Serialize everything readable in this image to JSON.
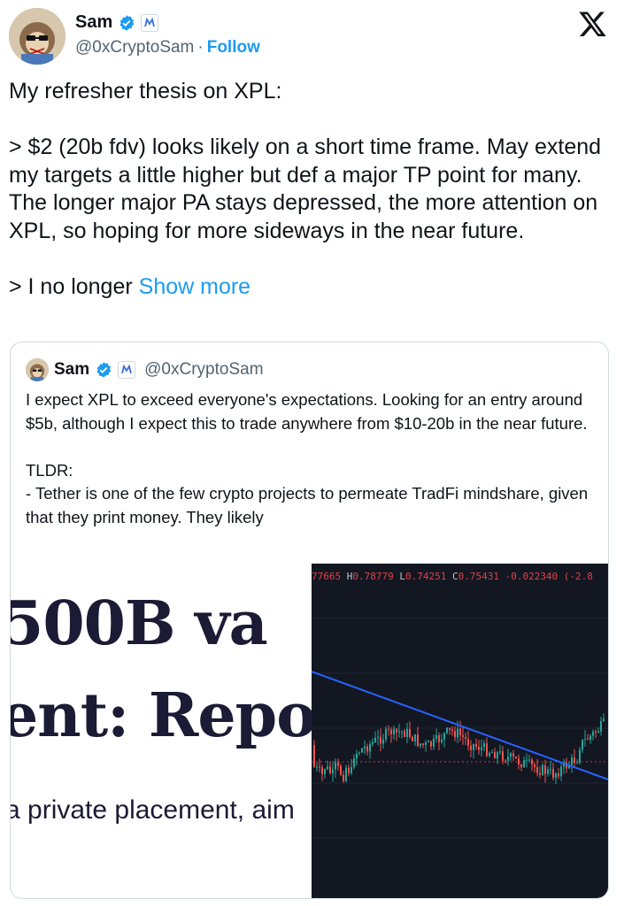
{
  "author": {
    "name": "Sam",
    "handle": "@0xCryptoSam",
    "separator": "·",
    "follow_label": "Follow"
  },
  "tweet": {
    "text": "My refresher thesis on XPL:\n\n> $2 (20b fdv) looks likely on a short time frame. May extend my targets a little higher but def a major TP point for many. The longer major PA stays depressed, the more attention on XPL, so hoping for more sideways in the near future.\n\n> I no longer ",
    "show_more": "Show more"
  },
  "quote": {
    "name": "Sam",
    "handle": "@0xCryptoSam",
    "text": "I expect XPL to exceed everyone's expectations. Looking for an entry around $5b, although I expect this to trade anywhere from $10-20b in the near future.\n\nTLDR:\n- Tether is one of the few crypto projects to permeate TradFi mindshare, given that they print money. They likely"
  },
  "media": {
    "headline_1": "500B va",
    "headline_2": "ent: Repo",
    "subline": "a private placement, aim",
    "ohlc": {
      "prefix": "77665",
      "h_label": "H",
      "h": "0.78779",
      "l_label": "L",
      "l": "0.74251",
      "c_label": "C",
      "c": "0.75431",
      "change": "-0.022340 (-2.8"
    }
  },
  "icons": [
    "verified-badge-icon",
    "affiliate-badge-icon",
    "x-logo-icon"
  ],
  "colors": {
    "accent": "#1d9bf0",
    "text": "#0f1419",
    "muted": "#536471",
    "chart_bg": "#131722",
    "up": "#26a69a",
    "down": "#ef5350",
    "trendline": "#2962ff"
  }
}
